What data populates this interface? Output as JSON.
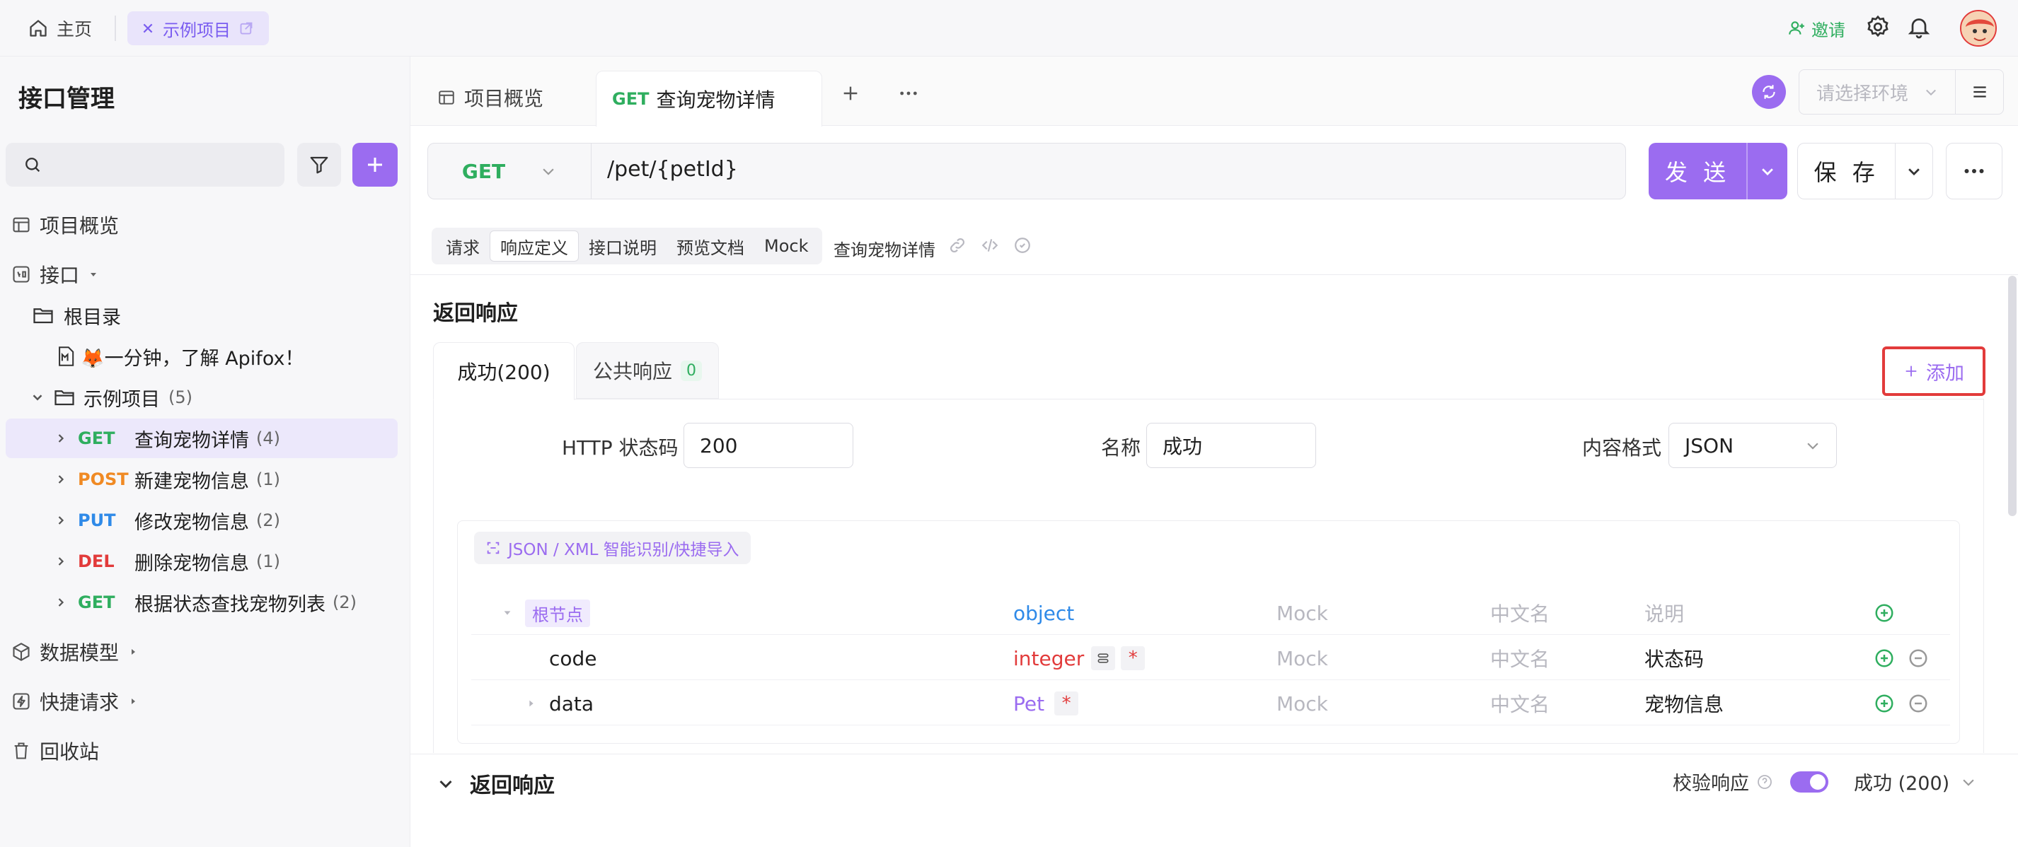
{
  "topbar": {
    "home_label": "主页",
    "project_tab_label": "示例项目",
    "invite_label": "邀请"
  },
  "sidebar": {
    "title": "接口管理",
    "search_placeholder": "",
    "items": {
      "overview": "项目概览",
      "api": "接口",
      "data_model": "数据模型",
      "quick_request": "快捷请求",
      "trash": "回收站"
    },
    "tree": {
      "root_label": "根目录",
      "doc_label": "🦊一分钟，了解 Apifox！",
      "folder_label": "示例项目",
      "folder_count": "(5)",
      "endpoints": [
        {
          "method": "GET",
          "name": "查询宠物详情",
          "count": "(4)"
        },
        {
          "method": "POST",
          "name": "新建宠物信息",
          "count": "(1)"
        },
        {
          "method": "PUT",
          "name": "修改宠物信息",
          "count": "(2)"
        },
        {
          "method": "DEL",
          "name": "删除宠物信息",
          "count": "(1)"
        },
        {
          "method": "GET",
          "name": "根据状态查找宠物列表",
          "count": "(2)"
        }
      ]
    }
  },
  "tabs": {
    "overview": "项目概览",
    "active_method": "GET",
    "active_name": "查询宠物详情",
    "env_placeholder": "请选择环境"
  },
  "request": {
    "method": "GET",
    "url": "/pet/{petId}",
    "send_label": "发 送",
    "save_label": "保 存"
  },
  "subtabs": {
    "items": [
      "请求",
      "响应定义",
      "接口说明",
      "预览文档",
      "Mock"
    ],
    "active_index": 1,
    "title": "查询宠物详情"
  },
  "response": {
    "section_title": "返回响应",
    "tab_success": "成功(200)",
    "tab_common": "公共响应",
    "tab_common_count": "0",
    "add_label": "添加",
    "status_code_label": "HTTP 状态码",
    "status_code_value": "200",
    "name_label": "名称",
    "name_value": "成功",
    "content_type_label": "内容格式",
    "content_type_value": "JSON",
    "smart_import_label": "JSON / XML 智能识别/快捷导入"
  },
  "schema": {
    "rows": [
      {
        "name": "根节点",
        "type": "object",
        "mock": "Mock",
        "cn_name": "中文名",
        "desc": "说明"
      },
      {
        "name": "code",
        "type": "integer",
        "mock": "Mock",
        "cn_name": "中文名",
        "desc": "状态码",
        "required": "*"
      },
      {
        "name": "data",
        "type": "Pet",
        "mock": "Mock",
        "cn_name": "中文名",
        "desc": "宠物信息",
        "required": "*"
      }
    ]
  },
  "bottom": {
    "title": "返回响应",
    "validate_label": "校验响应",
    "validate_on": true,
    "selected_response": "成功 (200)"
  },
  "colors": {
    "accent": "#9b6cf0",
    "get": "#2fae5f",
    "post": "#f08a24",
    "put": "#2f8ae8",
    "del": "#e23b3b"
  }
}
